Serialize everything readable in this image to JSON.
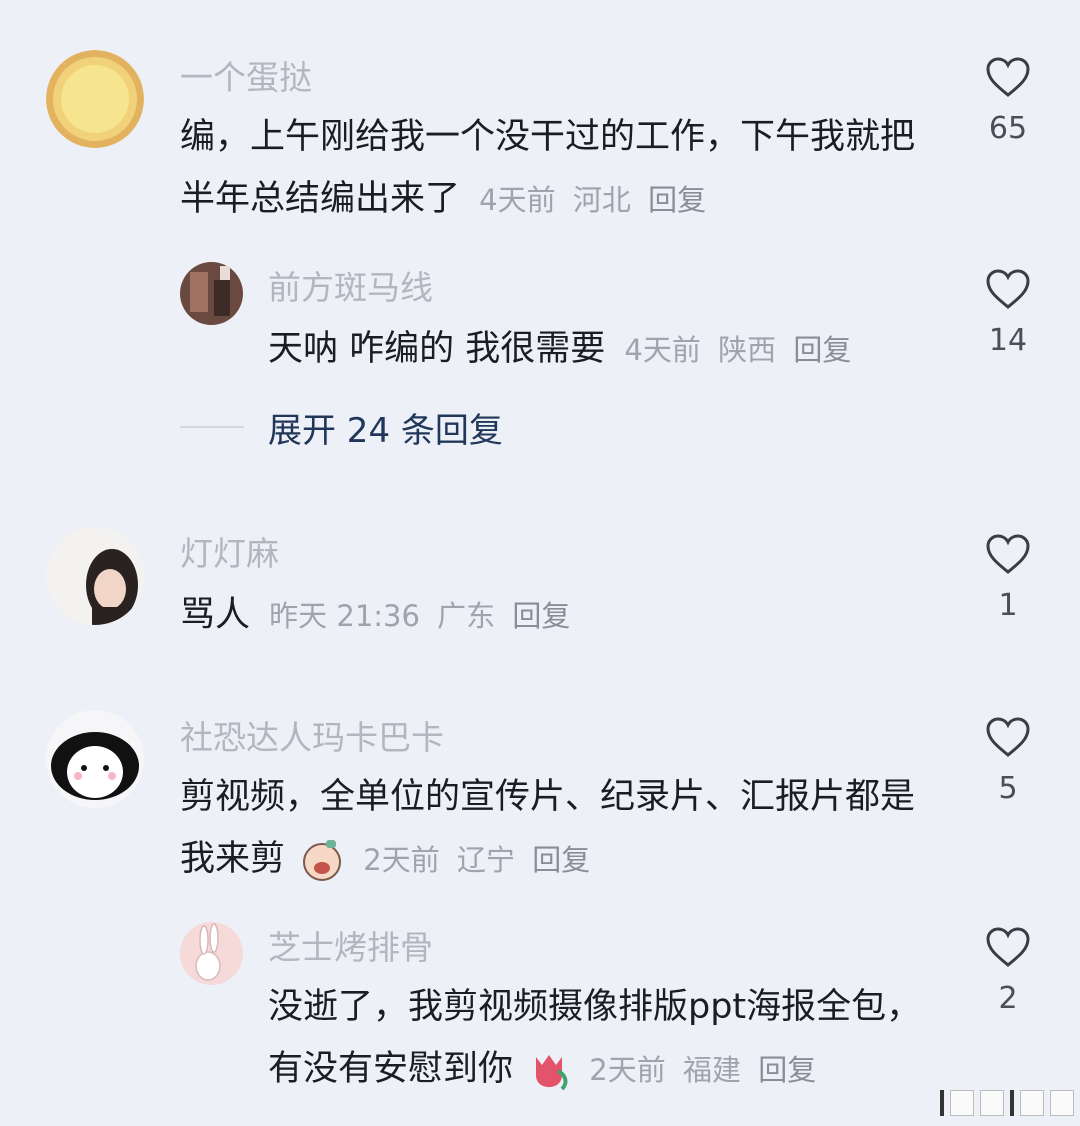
{
  "comments": [
    {
      "username": "一个蛋挞",
      "text": "编，上午刚给我一个没干过的工作，下午我就把半年总结编出来了",
      "time": "4天前",
      "location": "河北",
      "reply_label": "回复",
      "likes": "65",
      "replies": [
        {
          "username": "前方斑马线",
          "text": "天呐 咋编的 我很需要",
          "time": "4天前",
          "location": "陕西",
          "reply_label": "回复",
          "likes": "14"
        }
      ],
      "expand_label": "展开 24 条回复"
    },
    {
      "username": "灯灯麻",
      "text": "骂人",
      "time": "昨天 21:36",
      "location": "广东",
      "reply_label": "回复",
      "likes": "1"
    },
    {
      "username": "社恐达人玛卡巴卡",
      "text": "剪视频，全单位的宣传片、纪录片、汇报片都是我来剪",
      "time": "2天前",
      "location": "辽宁",
      "reply_label": "回复",
      "likes": "5",
      "replies": [
        {
          "username": "芝士烤排骨",
          "text": "没逝了，我剪视频摄像排版ppt海报全包，有没有安慰到你",
          "time": "2天前",
          "location": "福建",
          "reply_label": "回复",
          "likes": "2"
        }
      ]
    }
  ],
  "icons": {
    "like": "heart-outline-icon",
    "emoji_crying": "crying-face-emoji-icon",
    "emoji_tulip": "tulip-emoji-icon"
  },
  "colors": {
    "background": "#eef0f7",
    "username": "#b3b6bf",
    "text": "#1c1d22",
    "meta": "#a0a3ad",
    "expand": "#21375a"
  }
}
